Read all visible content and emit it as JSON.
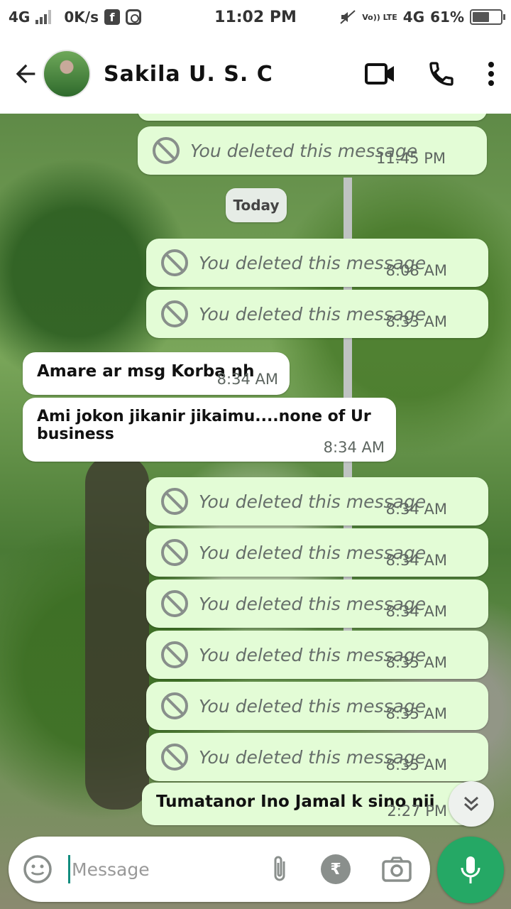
{
  "status_bar": {
    "network_left": "4G",
    "speed": "0K/s",
    "time": "11:02 PM",
    "volte": "Vo)) LTE",
    "network_right": "4G",
    "battery_percent": "61%",
    "battery_level": 0.61
  },
  "header": {
    "contact_name": "Sakila U. S. C"
  },
  "messages": [
    {
      "type": "deleted",
      "text": "You deleted this message",
      "time": "11:45 PM"
    },
    {
      "type": "date",
      "text": "Today"
    },
    {
      "type": "deleted",
      "text": "You deleted this message",
      "time": "8:08 AM"
    },
    {
      "type": "deleted",
      "text": "You deleted this message",
      "time": "8:33 AM"
    },
    {
      "type": "incoming",
      "text": "Amare ar msg Korba nh",
      "time": "8:34 AM"
    },
    {
      "type": "incoming",
      "text": "Ami jokon jikanir jikaimu....none of Ur business",
      "time": "8:34 AM"
    },
    {
      "type": "deleted",
      "text": "You deleted this message",
      "time": "8:34 AM"
    },
    {
      "type": "deleted",
      "text": "You deleted this message",
      "time": "8:34 AM"
    },
    {
      "type": "deleted",
      "text": "You deleted this message",
      "time": "8:34 AM"
    },
    {
      "type": "deleted",
      "text": "You deleted this message",
      "time": "8:35 AM"
    },
    {
      "type": "deleted",
      "text": "You deleted this message",
      "time": "8:35 AM"
    },
    {
      "type": "deleted",
      "text": "You deleted this message",
      "time": "8:35 AM"
    },
    {
      "type": "outgoing",
      "text": "Tumatanor Ino Jamal k sino nii",
      "time": "2:27 PM"
    }
  ],
  "composer": {
    "placeholder": "Message",
    "currency_symbol": "₹"
  },
  "icons": {
    "back": "back-arrow-icon",
    "video": "video-call-icon",
    "call": "phone-icon",
    "menu": "more-vert-icon",
    "emoji": "emoji-icon",
    "attach": "paperclip-icon",
    "payment": "rupee-icon",
    "camera": "camera-icon",
    "mic": "microphone-icon",
    "scroll": "double-chevron-down-icon"
  },
  "colors": {
    "outgoing_bubble": "#e3fcd6",
    "incoming_bubble": "#ffffff",
    "mic_button": "#25a865"
  }
}
